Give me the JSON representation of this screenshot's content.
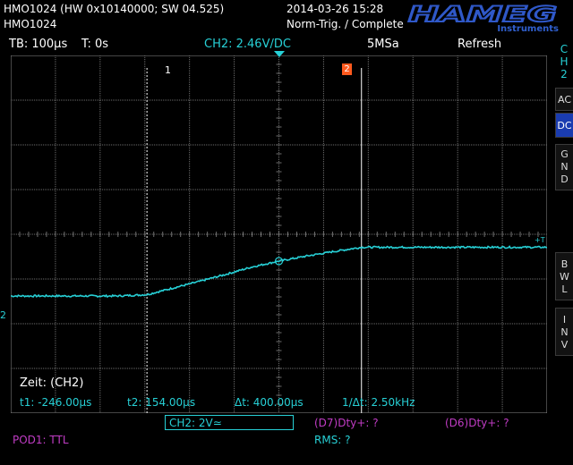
{
  "header": {
    "device_line1": "HMO1024 (HW 0x10140000; SW 04.525)",
    "device_line2": "HMO1024",
    "datetime": "2014-03-26 15:28",
    "trigger_status": "Norm-Trig. / Complete",
    "logo_main": "HAMEG",
    "logo_sub": "Instruments"
  },
  "topbar": {
    "timebase": "TB: 100µs",
    "trigger_time": "T: 0s",
    "trigger_level": "CH2: 2.46V",
    "trigger_slope": "/DC",
    "sample_rate": "5MSa",
    "mode": "Refresh"
  },
  "sidebar": {
    "channel": [
      "C",
      "H",
      "2"
    ],
    "buttons": [
      {
        "label": "AC",
        "active": false
      },
      {
        "label": "DC",
        "active": true
      },
      {
        "label": "GND",
        "active": false
      },
      {
        "label": "BWL",
        "active": false
      },
      {
        "label": "INV",
        "active": false
      }
    ]
  },
  "cursors": {
    "cursor1_label": "1",
    "cursor2_label": "2",
    "title": "Zeit: (CH2)",
    "t1": "t1: -246.00µs",
    "t2": "t2: 154.00µs",
    "dt": "Δt: 400.00µs",
    "inv_dt": "1/Δt: 2.50kHz"
  },
  "markers": {
    "ch2_ground": "2",
    "trigger_level": "+T"
  },
  "bottom": {
    "ch2_scale": "CH2: 2V≃",
    "meas1": "(D7)Dty+: ?",
    "meas2": "(D6)Dty+: ?",
    "rms": "RMS: ?",
    "pod": "POD1: TTL"
  },
  "chart_data": {
    "type": "line",
    "series": [
      {
        "x": [
          -500,
          -300,
          -246,
          -200,
          -150,
          -100,
          -50,
          0,
          50,
          100,
          154,
          200,
          300,
          500
        ],
        "y": [
          -2.76,
          -2.76,
          -2.7,
          -2.42,
          -2.12,
          -1.8,
          -1.46,
          -1.2,
          -0.98,
          -0.78,
          -0.58,
          -0.58,
          -0.58,
          -0.58
        ]
      }
    ],
    "x_unit": "µs",
    "y_unit": "V",
    "xlim": [
      -500,
      500
    ],
    "ylim": [
      -8,
      8
    ],
    "grid": true,
    "colors": {
      "trace": "#27d0d6",
      "grid": "#6e6e6e",
      "cursor": "#ffffff",
      "marker2": "#ff5a1e"
    }
  }
}
